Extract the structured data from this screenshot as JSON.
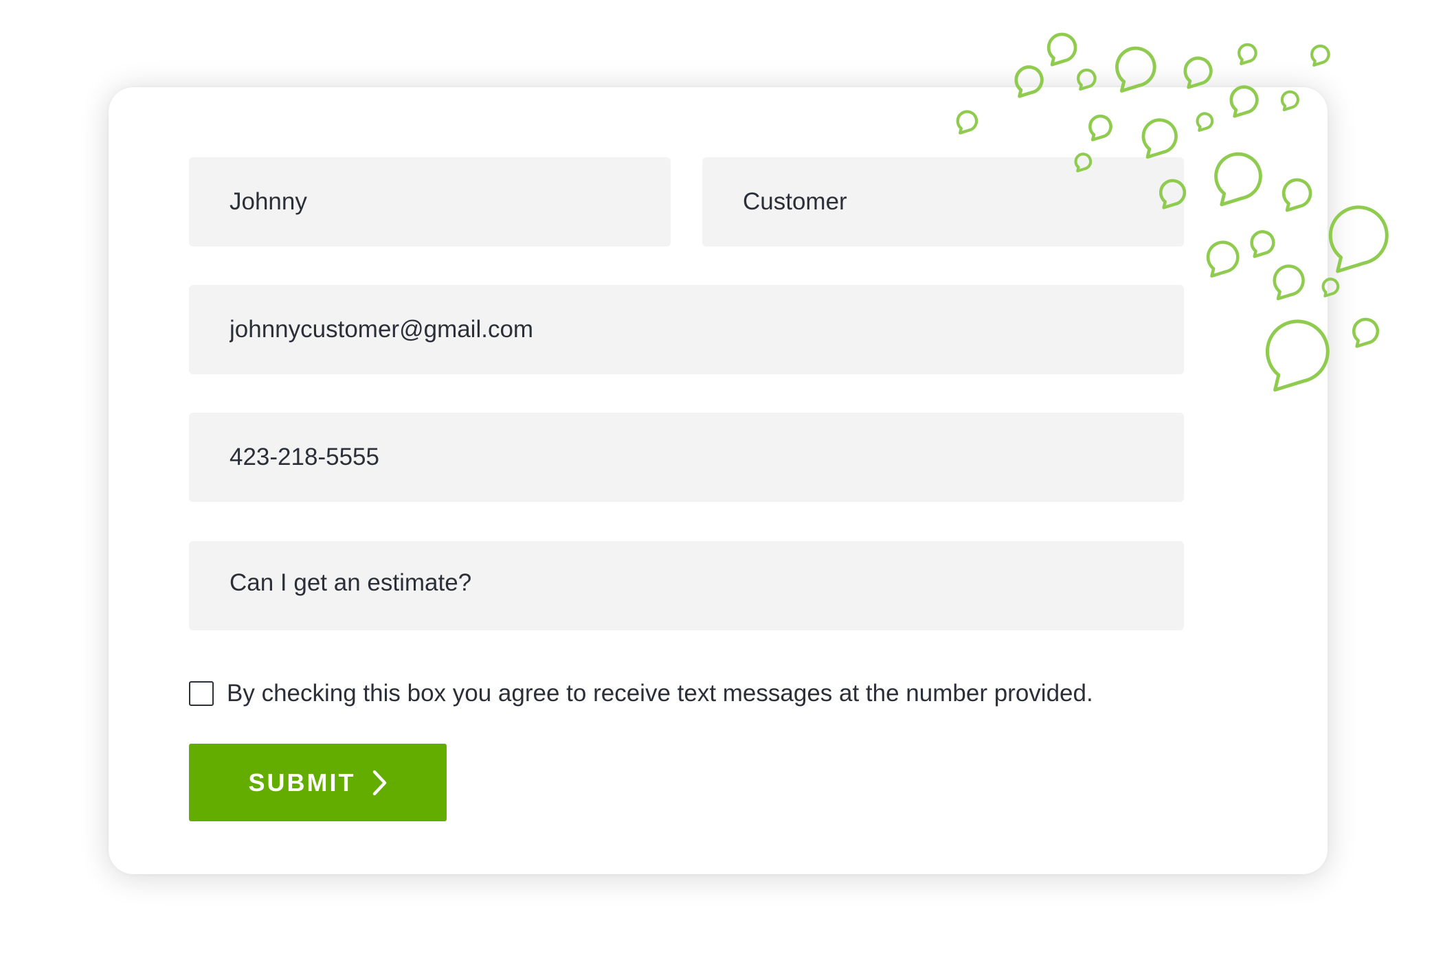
{
  "form": {
    "first_name": "Johnny",
    "last_name": "Customer",
    "email": "johnnycustomer@gmail.com",
    "phone": "423-218-5555",
    "message": "Can I get an estimate?",
    "consent_checked": false,
    "consent_label": "By checking this box you agree to receive text messages at the number provided.",
    "submit_label": "SUBMIT"
  },
  "colors": {
    "accent": "#62ad00",
    "bubble": "#8fcb4f",
    "field_bg": "#f3f3f3",
    "text": "#2b2f38"
  },
  "icons": {
    "submit_arrow": "chevron-right-icon",
    "decoration": "chat-bubble-icon"
  }
}
